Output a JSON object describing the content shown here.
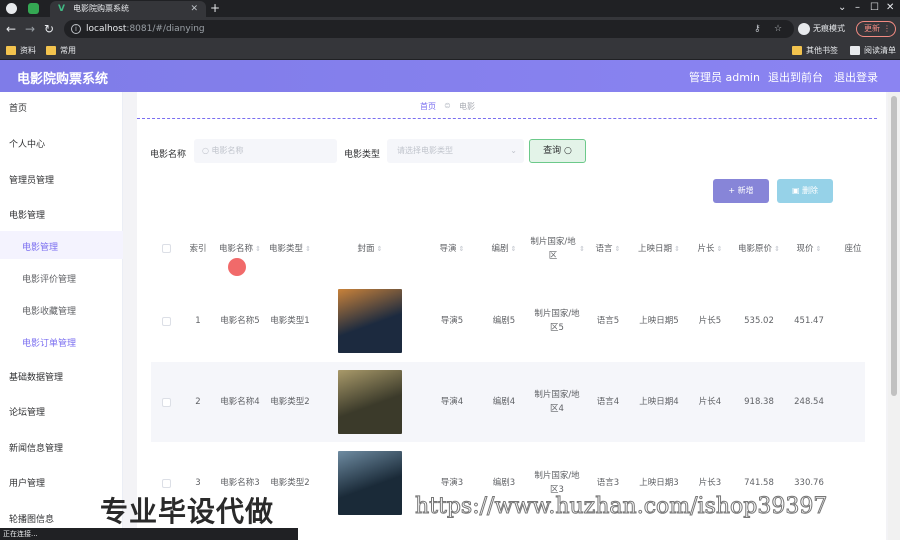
{
  "browser": {
    "tab_title": "电影院购票系统",
    "tab_icon": "vue-logo-icon",
    "new_tab": "+",
    "url_host": "localhost",
    "url_path": ":8081/#/dianying",
    "profile_label": "无痕模式",
    "update_label": "更新",
    "bookmarks": [
      "资料",
      "常用"
    ],
    "bookmarks_right": [
      "其他书签",
      "阅读清单"
    ],
    "status_text": "正在连接..."
  },
  "header": {
    "title": "电影院购票系统",
    "admin_label": "管理员 admin",
    "back_label": "退出到前台",
    "logout_label": "退出登录"
  },
  "sidebar": {
    "items": [
      {
        "label": "首页",
        "type": "top"
      },
      {
        "label": "个人中心",
        "type": "top"
      },
      {
        "label": "管理员管理",
        "type": "top"
      },
      {
        "label": "电影管理",
        "type": "top"
      },
      {
        "label": "电影管理",
        "type": "sub-active"
      },
      {
        "label": "电影评价管理",
        "type": "sub"
      },
      {
        "label": "电影收藏管理",
        "type": "sub"
      },
      {
        "label": "电影订单管理",
        "type": "sub-accent"
      },
      {
        "label": "基础数据管理",
        "type": "top"
      },
      {
        "label": "论坛管理",
        "type": "top"
      },
      {
        "label": "新闻信息管理",
        "type": "top"
      },
      {
        "label": "用户管理",
        "type": "top"
      },
      {
        "label": "轮播图信息",
        "type": "top"
      }
    ]
  },
  "breadcrumb": {
    "home": "首页",
    "separator": "⊜",
    "current": "电影"
  },
  "search": {
    "name_label": "电影名称",
    "name_placeholder": "电影名称",
    "type_label": "电影类型",
    "type_placeholder": "请选择电影类型",
    "button_label": "查询"
  },
  "actions": {
    "add_label": "新增",
    "delete_label": "删除"
  },
  "table": {
    "columns": [
      "索引",
      "电影名称",
      "电影类型",
      "封面",
      "导演",
      "编剧",
      "制片国家/地区",
      "语言",
      "上映日期",
      "片长",
      "电影原价",
      "现价",
      "座位"
    ],
    "rows": [
      {
        "index": "1",
        "name": "电影名称5",
        "type": "电影类型1",
        "director": "导演5",
        "writer": "编剧5",
        "country": "制片国家/地区5",
        "language": "语言5",
        "release": "上映日期5",
        "duration": "片长5",
        "original_price": "535.02",
        "price": "451.47",
        "poster_colors": [
          "#1c2a3f",
          "#c9823a"
        ]
      },
      {
        "index": "2",
        "name": "电影名称4",
        "type": "电影类型2",
        "director": "导演4",
        "writer": "编剧4",
        "country": "制片国家/地区4",
        "language": "语言4",
        "release": "上映日期4",
        "duration": "片长4",
        "original_price": "918.38",
        "price": "248.54",
        "poster_colors": [
          "#3b3a2a",
          "#a99a6a"
        ]
      },
      {
        "index": "3",
        "name": "电影名称3",
        "type": "电影类型2",
        "director": "导演3",
        "writer": "编剧3",
        "country": "制片国家/地区3",
        "language": "语言3",
        "release": "上映日期3",
        "duration": "片长3",
        "original_price": "741.58",
        "price": "330.76",
        "poster_colors": [
          "#1a2a38",
          "#6f8ca2"
        ]
      }
    ]
  },
  "watermark": {
    "cn": "专业毕设代做",
    "url": "https://www.huzhan.com/ishop39397"
  },
  "colors": {
    "accent": "#7b6ff0",
    "header_bg": "#8380ec",
    "search_border": "#6cc98a"
  }
}
